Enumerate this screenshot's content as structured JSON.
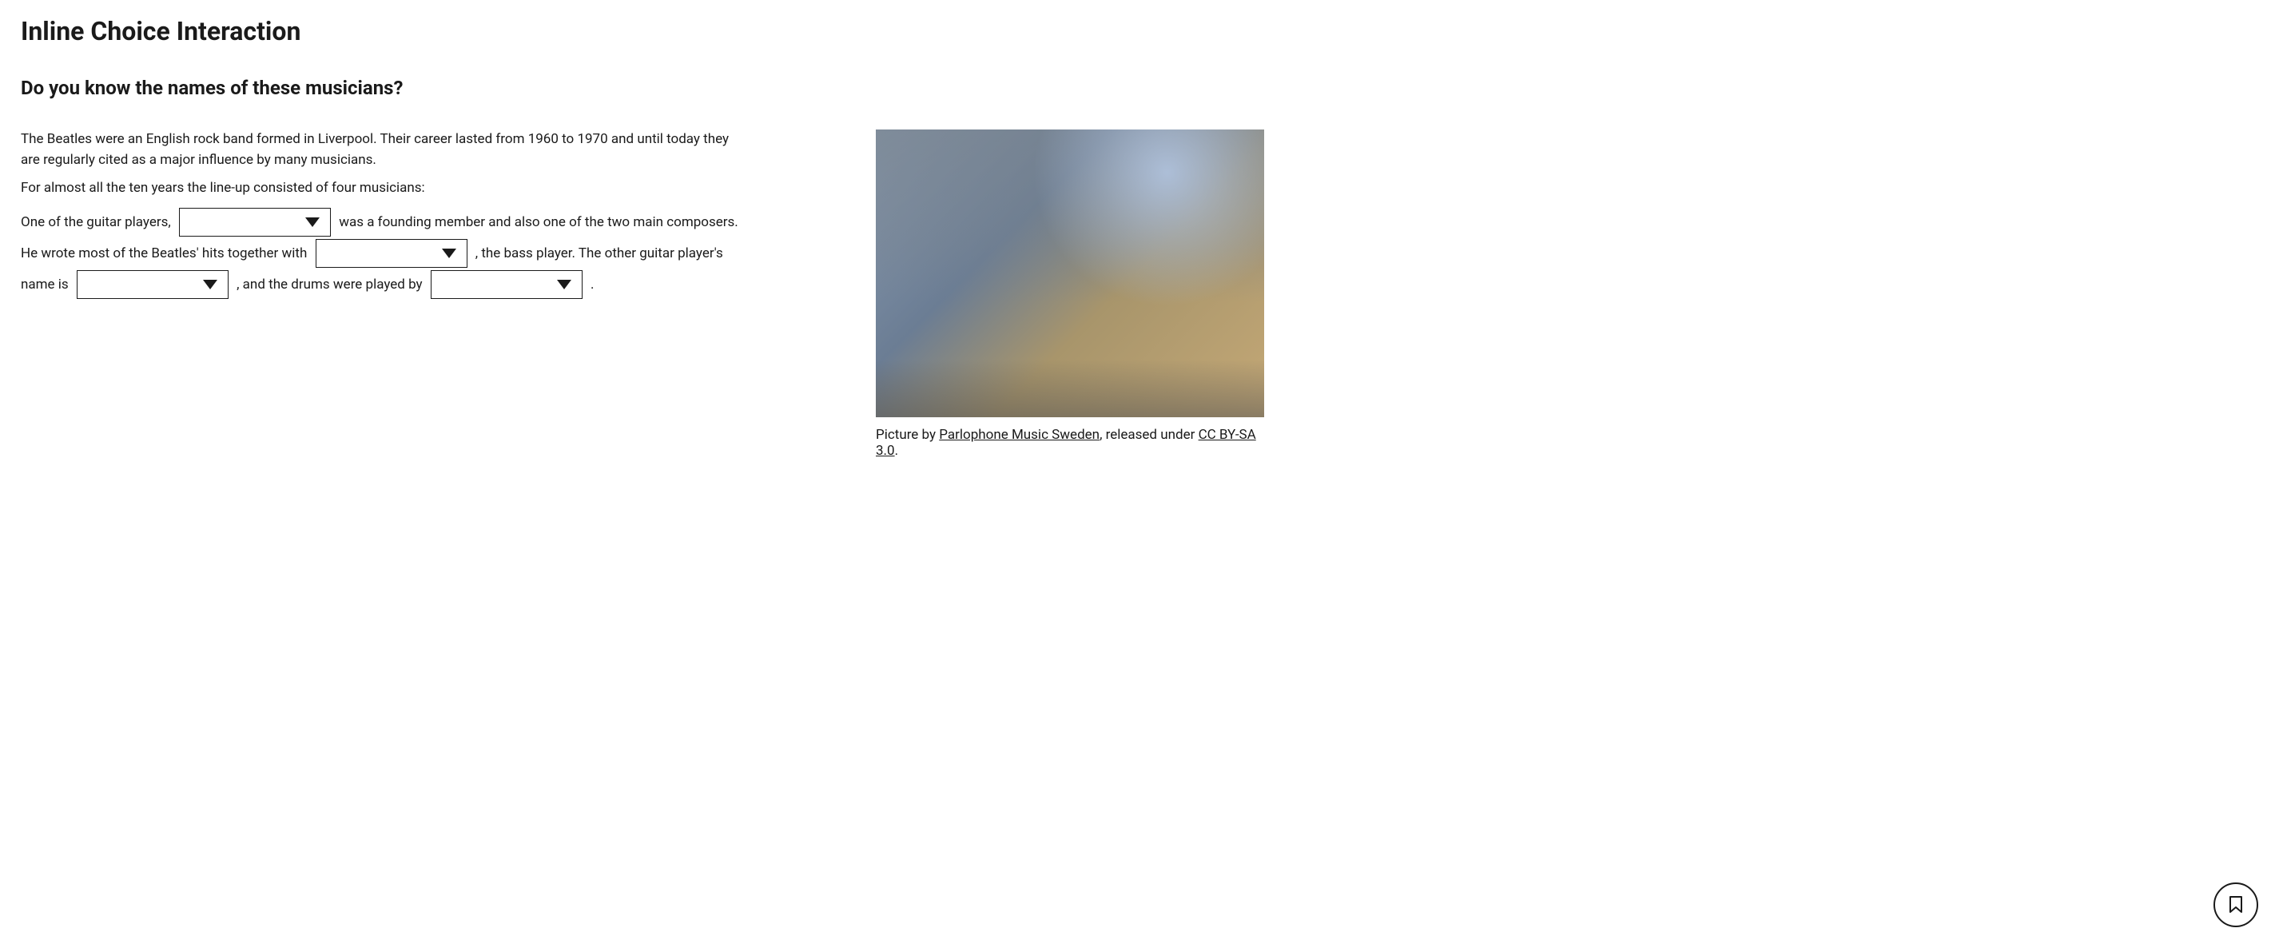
{
  "page_title": "Inline Choice Interaction",
  "question_heading": "Do you know the names of these musicians?",
  "intro_paragraph": "The Beatles were an English rock band formed in Liverpool. Their career lasted from 1960 to 1970 and until today they are regularly cited as a major influence by many musicicians.",
  "intro_paragraph_fixed": "The Beatles were an English rock band formed in Liverpool. Their career lasted from 1960 to 1970 and until today they are regularly cited as a major influence by many musicians.",
  "lineup_paragraph": "For almost all the ten years the line-up consisted of four musicians:",
  "fill_in": {
    "part1": "One of the guitar players, ",
    "part2": " was a founding member and also one of the two main composers. He wrote most of the Beatles' hits together with ",
    "part3": " , the bass player. The other guitar player's name is ",
    "part4": " , and the drums were played by ",
    "part5": " ."
  },
  "selects": {
    "select1": {
      "value": ""
    },
    "select2": {
      "value": ""
    },
    "select3": {
      "value": ""
    },
    "select4": {
      "value": ""
    }
  },
  "caption": {
    "prefix": "Picture by ",
    "source_link": "Parlophone Music Sweden",
    "middle": ", released under ",
    "license_link": "CC BY-SA 3.0",
    "suffix": "."
  }
}
